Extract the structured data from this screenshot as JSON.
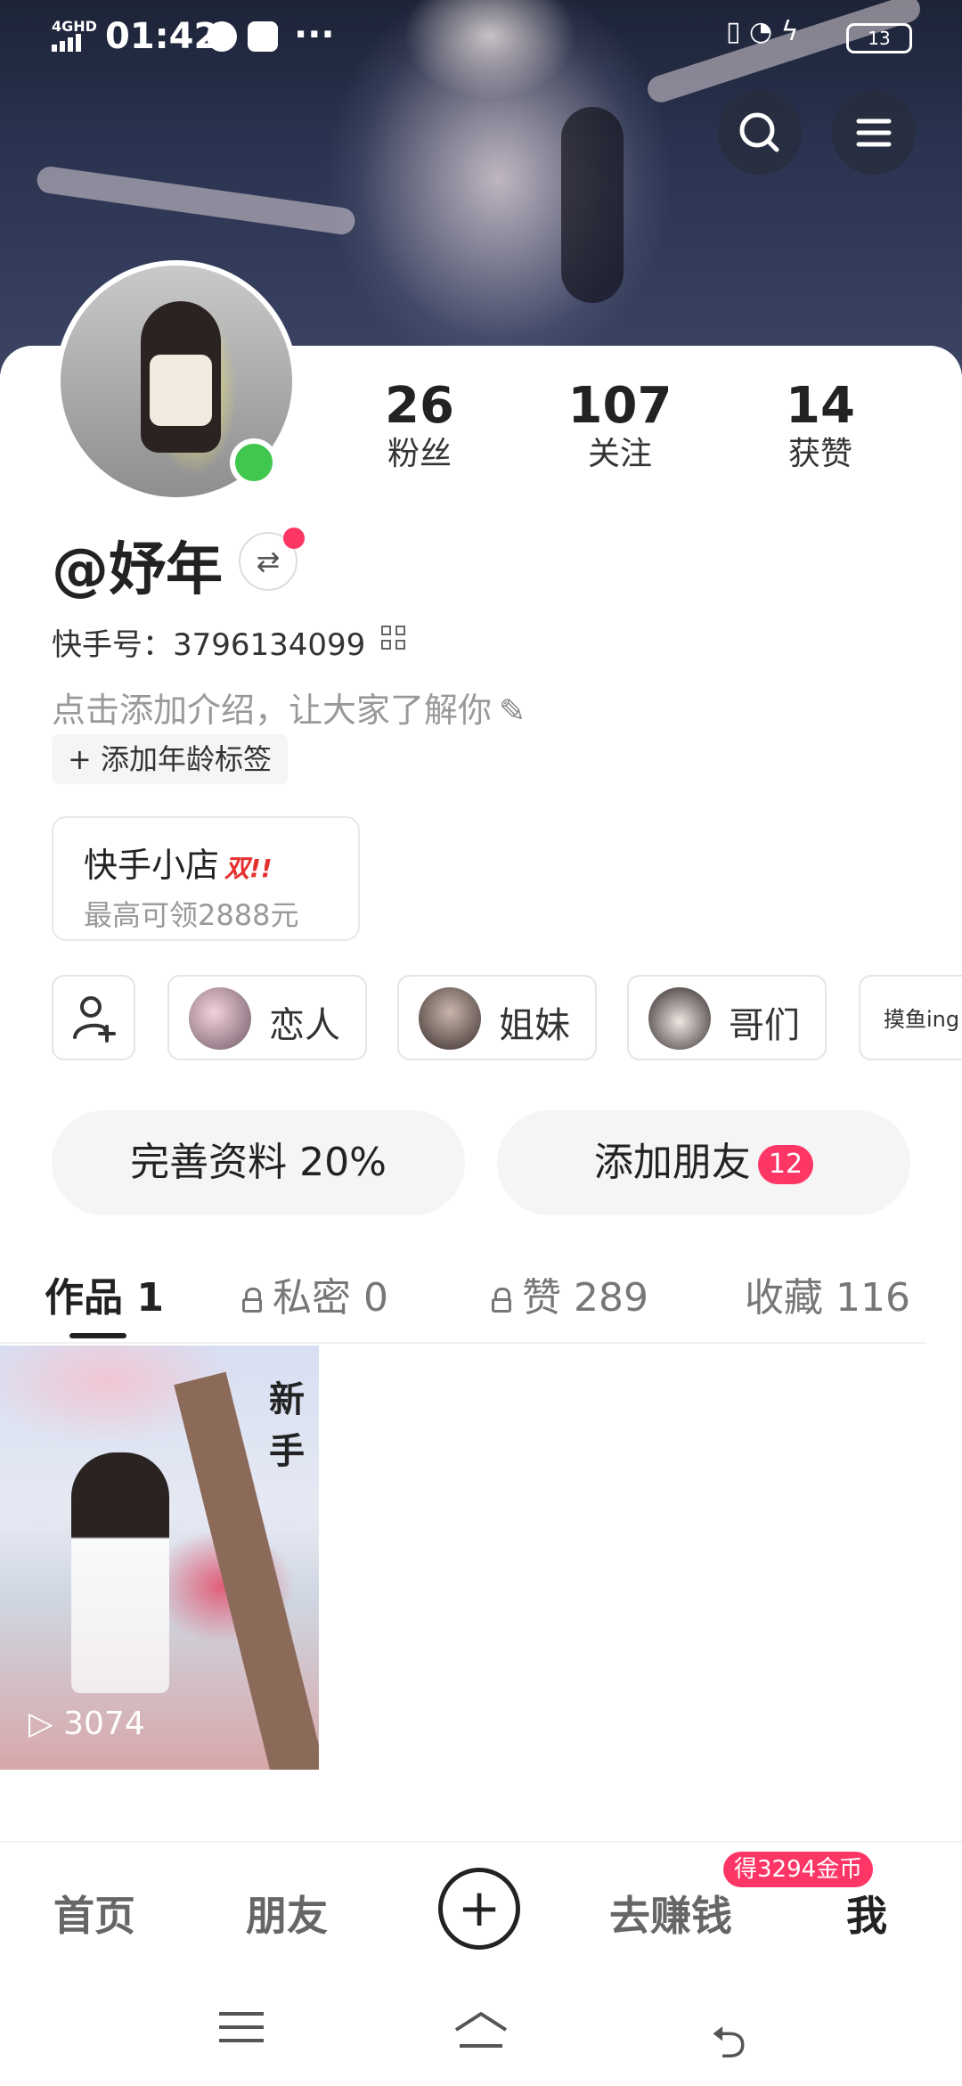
{
  "status_bar": {
    "network": "4GHD",
    "time": "01:42",
    "more": "···",
    "battery": "13"
  },
  "profile": {
    "stats": [
      {
        "value": "26",
        "label": "粉丝"
      },
      {
        "value": "107",
        "label": "关注"
      },
      {
        "value": "14",
        "label": "获赞"
      }
    ],
    "username": "@妤年",
    "kuaishou_id": "快手号：3796134099",
    "intro_placeholder": "点击添加介绍，让大家了解你",
    "age_tag": "+ 添加年龄标签",
    "online": true
  },
  "shop": {
    "title": "快手小店",
    "badge": "双!!",
    "subtitle": "最高可领2888元"
  },
  "relations": [
    {
      "label": "恋人"
    },
    {
      "label": "姐妹"
    },
    {
      "label": "哥们"
    },
    {
      "label": "摸鱼ing"
    }
  ],
  "actions": {
    "complete_profile": "完善资料 20%",
    "add_friends": "添加朋友",
    "add_friends_count": "12"
  },
  "tabs": [
    {
      "label": "作品 1",
      "locked": false,
      "active": true
    },
    {
      "label": "私密 0",
      "locked": true,
      "active": false
    },
    {
      "label": "赞 289",
      "locked": true,
      "active": false
    },
    {
      "label": "收藏 116",
      "locked": false,
      "active": false
    }
  ],
  "works": [
    {
      "overlay_text": "新手",
      "plays": "3074"
    }
  ],
  "bottom_nav": {
    "items": [
      "首页",
      "朋友",
      "去赚钱",
      "我"
    ],
    "active": "我",
    "earn_badge": "得3294金币"
  },
  "colors": {
    "accent": "#fe3666",
    "online": "#3fc74e"
  }
}
